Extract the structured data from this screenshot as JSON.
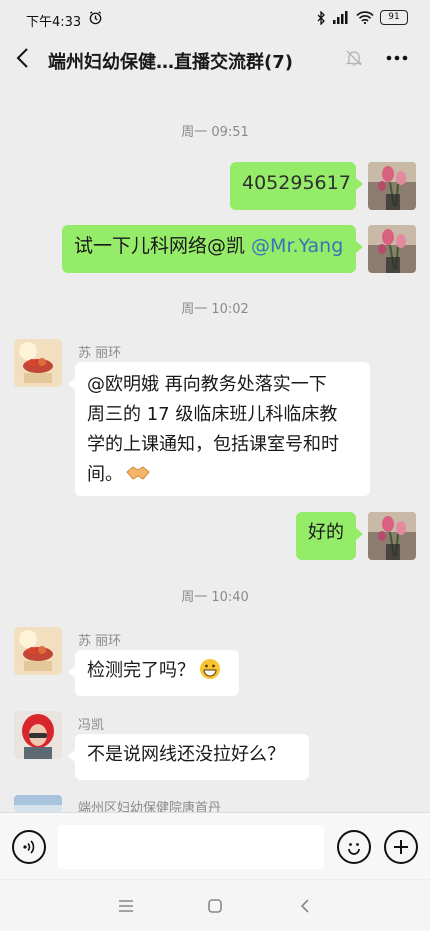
{
  "status_bar": {
    "time": "下午4:33",
    "battery": "91"
  },
  "header": {
    "title": "端州妇幼保健…直播交流群(7)"
  },
  "timestamps": [
    "周一 09:51",
    "周一 10:02",
    "周一 10:40"
  ],
  "messages": [
    {
      "from": "me",
      "text": "405295617"
    },
    {
      "from": "me",
      "text": "试一下儿科网络@凯 ",
      "mention": "@Mr.Yang"
    },
    {
      "from": "other",
      "sender": "苏 丽环",
      "lines": [
        "@欧明娥  再向教务处落实一下",
        "周三的 17 级临床班儿科临床教",
        "学的上课通知，包括课室号和时",
        "间。"
      ]
    },
    {
      "from": "me",
      "text": "好的"
    },
    {
      "from": "other",
      "sender": "苏 丽环",
      "text": "检测完了吗？"
    },
    {
      "from": "other",
      "sender": "冯凯",
      "text": "不是说网线还没拉好么？"
    },
    {
      "from": "other",
      "sender": "端州区妇幼保健院唐首丹"
    }
  ],
  "colors": {
    "my_bubble": "#95ec69",
    "other_bubble": "#ffffff",
    "mention": "#3c72b8",
    "background": "#ededed"
  },
  "icons": [
    "back-arrow-icon",
    "mute-bell-icon",
    "more-icon",
    "voice-icon",
    "emoji-icon",
    "plus-icon",
    "menu-icon",
    "home-icon",
    "back-nav-icon"
  ]
}
